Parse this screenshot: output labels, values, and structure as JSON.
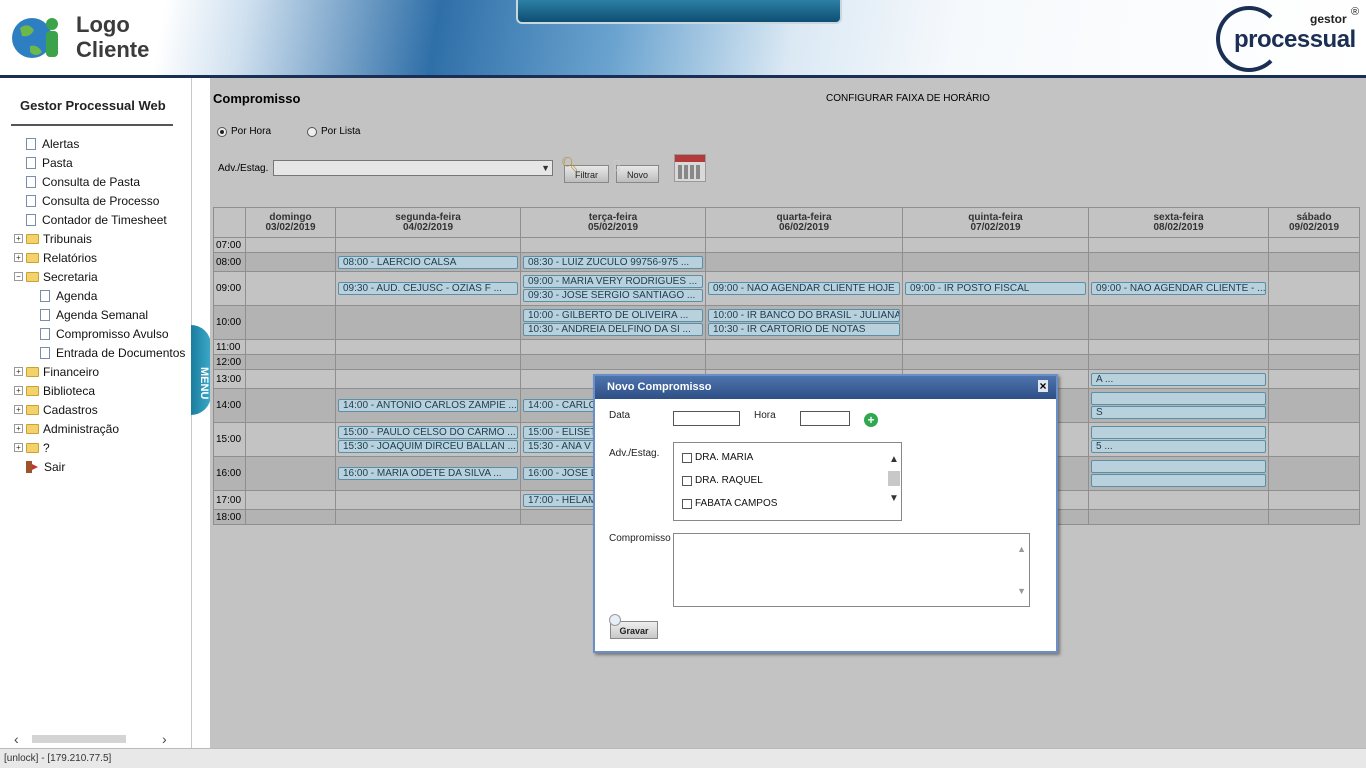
{
  "header": {
    "logo_line1": "Logo",
    "logo_line2": "Cliente",
    "brand_small": "gestor",
    "brand_reg": "®",
    "brand_big": "processual"
  },
  "sidebar": {
    "title": "Gestor Processual Web",
    "items": [
      {
        "label": "Alertas",
        "kind": "doc",
        "level": 0
      },
      {
        "label": "Pasta",
        "kind": "doc",
        "level": 0
      },
      {
        "label": "Consulta de Pasta",
        "kind": "doc",
        "level": 0
      },
      {
        "label": "Consulta de Processo",
        "kind": "doc",
        "level": 0
      },
      {
        "label": "Contador de Timesheet",
        "kind": "doc",
        "level": 0
      },
      {
        "label": "Tribunais",
        "kind": "folder",
        "level": 0,
        "expander": "+"
      },
      {
        "label": "Relatórios",
        "kind": "folder",
        "level": 0,
        "expander": "+"
      },
      {
        "label": "Secretaria",
        "kind": "folder",
        "level": 0,
        "expander": "−"
      },
      {
        "label": "Agenda",
        "kind": "doc",
        "level": 1
      },
      {
        "label": "Agenda Semanal",
        "kind": "doc",
        "level": 1
      },
      {
        "label": "Compromisso Avulso",
        "kind": "doc",
        "level": 1
      },
      {
        "label": "Entrada de Documentos",
        "kind": "doc",
        "level": 1
      },
      {
        "label": "Financeiro",
        "kind": "folder",
        "level": 0,
        "expander": "+"
      },
      {
        "label": "Biblioteca",
        "kind": "folder",
        "level": 0,
        "expander": "+"
      },
      {
        "label": "Cadastros",
        "kind": "folder",
        "level": 0,
        "expander": "+"
      },
      {
        "label": "Administração",
        "kind": "folder",
        "level": 0,
        "expander": "+"
      },
      {
        "label": "?",
        "kind": "folder",
        "level": 0,
        "expander": "+"
      },
      {
        "label": "Sair",
        "kind": "exit",
        "level": 0
      }
    ],
    "menu_tab": "MENU"
  },
  "main": {
    "title": "Compromisso",
    "config_link": "CONFIGURAR FAIXA DE HORÁRIO",
    "radio_hora": "Por Hora",
    "radio_lista": "Por Lista",
    "adv_label": "Adv./Estag.",
    "btn_filtrar": "Filtrar",
    "btn_novo": "Novo"
  },
  "agenda": {
    "days": [
      {
        "name": "domingo",
        "date": "03/02/2019"
      },
      {
        "name": "segunda-feira",
        "date": "04/02/2019"
      },
      {
        "name": "terça-feira",
        "date": "05/02/2019"
      },
      {
        "name": "quarta-feira",
        "date": "06/02/2019"
      },
      {
        "name": "quinta-feira",
        "date": "07/02/2019"
      },
      {
        "name": "sexta-feira",
        "date": "08/02/2019"
      },
      {
        "name": "sábado",
        "date": "09/02/2019"
      }
    ],
    "rows": [
      {
        "time": "07:00",
        "cells": [
          [],
          [],
          [],
          [],
          [],
          [],
          []
        ]
      },
      {
        "time": "08:00",
        "cells": [
          [],
          [
            "08:00 - LAERCIO CALSA"
          ],
          [
            "08:30 - LUIZ ZUCULO 99756-975 ..."
          ],
          [],
          [],
          [],
          []
        ]
      },
      {
        "time": "09:00",
        "cells": [
          [],
          [
            "09:30 - AUD. CEJUSC - OZIAS F ..."
          ],
          [
            "09:00 - MARIA VERY RODRIGUES ...",
            "09:30 - JOSE SERGIO SANTIAGO ..."
          ],
          [
            "09:00 - NÃO AGENDAR CLIENTE HOJE"
          ],
          [
            "09:00 - IR POSTO FISCAL"
          ],
          [
            "09:00 - NÃO AGENDAR CLIENTE - ..."
          ],
          []
        ]
      },
      {
        "time": "10:00",
        "cells": [
          [],
          [],
          [
            "10:00 - GILBERTO DE OLIVEIRA ...",
            "10:30 - ANDREIA DELFINO DA SI ..."
          ],
          [
            "10:00 - IR BANCO DO BRASIL - JULIANA",
            "10:30 - IR CARTÓRIO DE NOTAS"
          ],
          [],
          [],
          []
        ]
      },
      {
        "time": "11:00",
        "cells": [
          [],
          [],
          [],
          [],
          [],
          [],
          []
        ]
      },
      {
        "time": "12:00",
        "cells": [
          [],
          [],
          [],
          [],
          [],
          [],
          []
        ]
      },
      {
        "time": "13:00",
        "cells": [
          [],
          [],
          [],
          [],
          [],
          [
            "A ..."
          ],
          []
        ]
      },
      {
        "time": "14:00",
        "cells": [
          [],
          [
            "14:00 - ANTONIO CARLOS ZAMPIE ..."
          ],
          [
            "14:00 - CARLO"
          ],
          [],
          [],
          [
            "",
            "S"
          ],
          []
        ]
      },
      {
        "time": "15:00",
        "cells": [
          [],
          [
            "15:00 - PAULO CELSO DO CARMO ...",
            "15:30 - JOAQUIM DIRCEU BALLAN ..."
          ],
          [
            "15:00 - ELISET",
            "15:30 - ANA V"
          ],
          [],
          [],
          [
            "",
            "5 ..."
          ],
          []
        ]
      },
      {
        "time": "16:00",
        "cells": [
          [],
          [
            "16:00 - MARIA ODETE DA SILVA ..."
          ],
          [
            "16:00 - JOSE L"
          ],
          [],
          [],
          [
            "",
            ""
          ],
          []
        ]
      },
      {
        "time": "17:00",
        "cells": [
          [],
          [],
          [
            "17:00 - HELAM"
          ],
          [],
          [],
          [],
          []
        ]
      },
      {
        "time": "18:00",
        "cells": [
          [],
          [],
          [],
          [],
          [],
          [],
          []
        ]
      }
    ]
  },
  "dialog": {
    "title": "Novo Compromisso",
    "close": "×",
    "data_label": "Data",
    "hora_label": "Hora",
    "data_value": "",
    "hora_value": "",
    "adv_label": "Adv./Estag.",
    "options": [
      "DRA. MARIA",
      "DRA. RAQUEL",
      "FABATA CAMPOS"
    ],
    "comp_label": "Compromisso",
    "comp_value": "",
    "btn_gravar": "Gravar"
  },
  "status": "[unlock] - [179.210.77.5]"
}
